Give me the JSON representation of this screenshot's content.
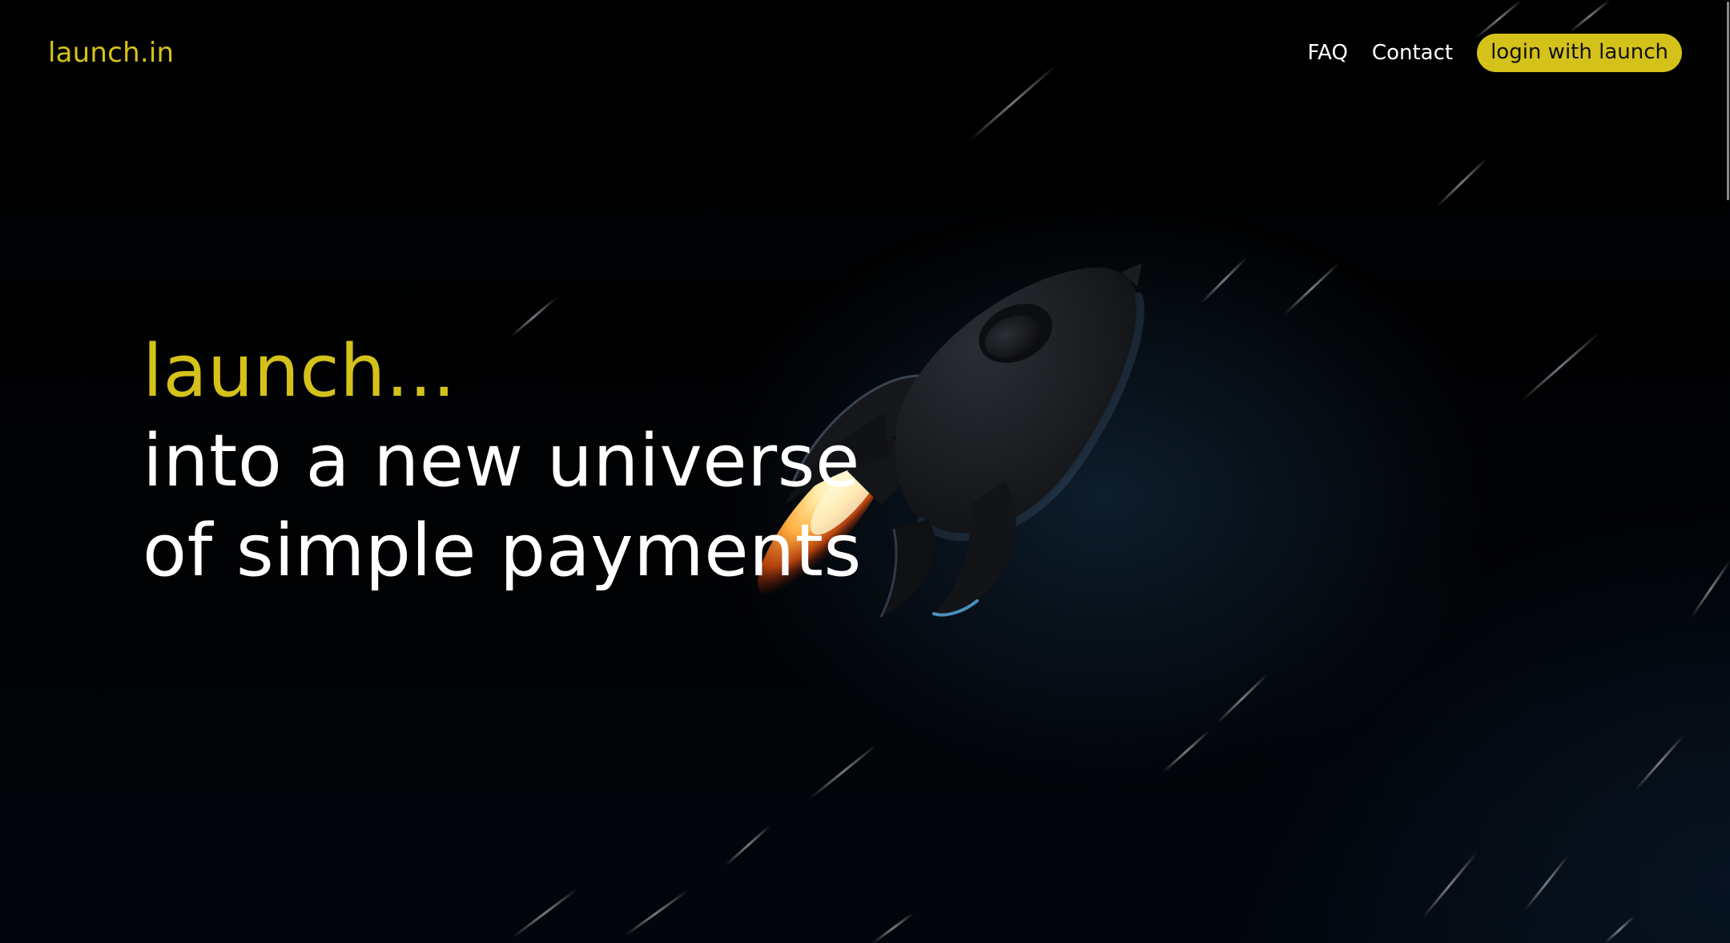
{
  "header": {
    "logo_text": "launch.in",
    "nav": {
      "faq_label": "FAQ",
      "contact_label": "Contact",
      "login_label": "login with launch"
    }
  },
  "hero": {
    "line1": "launch...",
    "line2": "into a new universe",
    "line3": "of simple payments"
  },
  "colors": {
    "accent": "#d4c21a",
    "background": "#000000",
    "text": "#ffffff"
  },
  "icons": {
    "rocket": "rocket-illustration"
  }
}
